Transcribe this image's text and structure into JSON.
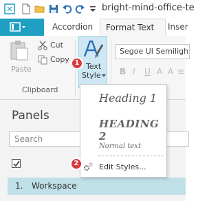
{
  "window": {
    "title": "bright-mind-office-te"
  },
  "tabs": {
    "accordion": "Accordion",
    "format_text": "Format Text",
    "insert": "Inser"
  },
  "ribbon": {
    "paste": "Paste",
    "cut": "Cut",
    "copy": "Copy",
    "clipboard_group": "Clipboard",
    "text_style_line1": "Text",
    "text_style_line2": "Style",
    "font_name": "Segoe UI Semilight",
    "format_buttons": [
      "B",
      "I",
      "U",
      "A",
      "A",
      "≡"
    ]
  },
  "badges": {
    "one": "1",
    "two": "2"
  },
  "panel": {
    "title": "Panels",
    "search_placeholder": "Search",
    "row_number": "1.",
    "row_label": "Workspace"
  },
  "dropdown": {
    "heading1": "Heading 1",
    "heading2": "HEADING 2",
    "normal": "Normal text",
    "edit_styles": "Edit Styles..."
  },
  "colors": {
    "accent": "#1f9fc1",
    "badge": "#d9383d",
    "selected_row": "#bfe0e6"
  }
}
